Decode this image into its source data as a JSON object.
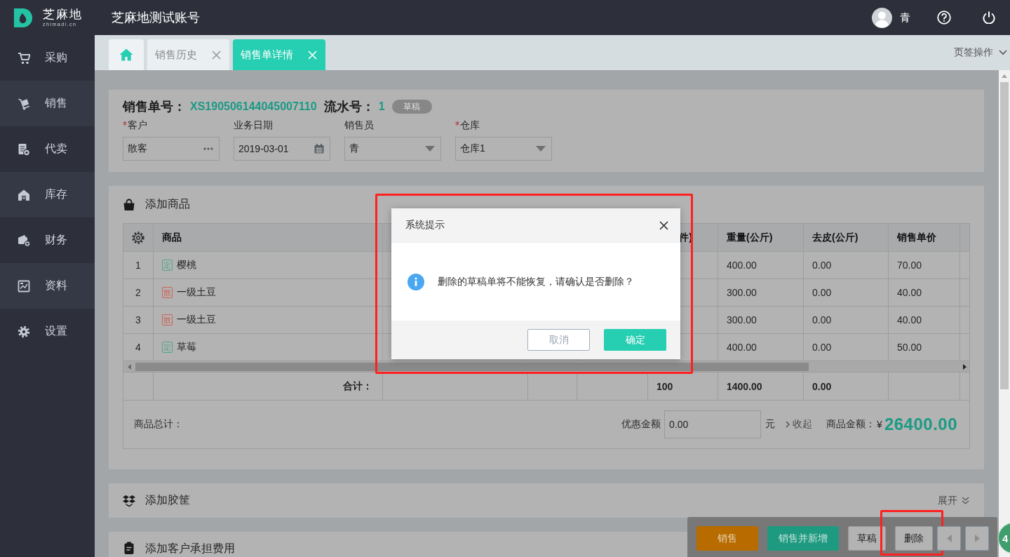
{
  "header": {
    "brand": "芝麻地",
    "domain": "zhimadi.cn",
    "account": "芝麻地测试账号",
    "user": "青"
  },
  "sidebar": {
    "items": [
      {
        "label": "采购"
      },
      {
        "label": "销售"
      },
      {
        "label": "代卖"
      },
      {
        "label": "库存"
      },
      {
        "label": "财务"
      },
      {
        "label": "资料"
      },
      {
        "label": "设置"
      }
    ]
  },
  "tabs": [
    {
      "kind": "home",
      "selected": false
    },
    {
      "kind": "page",
      "label": "销售历史",
      "selected": false,
      "closable": true
    },
    {
      "kind": "page",
      "label": "销售单详情",
      "selected": true,
      "closable": true
    }
  ],
  "tab_actions": "页签操作",
  "order": {
    "number_label": "销售单号：",
    "number": "XS190506144045007110",
    "serial_label": "流水号：",
    "serial": "1",
    "status": "草稿",
    "fields": [
      {
        "label": "客户",
        "required": true,
        "kind": "picker",
        "value": "散客"
      },
      {
        "label": "业务日期",
        "required": false,
        "kind": "date",
        "value": "2019-03-01"
      },
      {
        "label": "销售员",
        "required": false,
        "kind": "select",
        "value": "青"
      },
      {
        "label": "仓库",
        "required": true,
        "kind": "select",
        "value": "仓库1"
      }
    ]
  },
  "goods": {
    "title": "添加商品",
    "table": {
      "columns": [
        {
          "label": "商品"
        },
        {
          "label": "件)"
        },
        {
          "label": "重量(公斤)"
        },
        {
          "label": "去皮(公斤)"
        },
        {
          "label": "销售单价"
        }
      ],
      "rows": [
        {
          "index": "1",
          "tag": {
            "text": "定",
            "color": "#52a389"
          },
          "name": "樱桃",
          "weight": "400.00",
          "tare": "0.00",
          "price": "70.00"
        },
        {
          "index": "2",
          "tag": {
            "text": "散",
            "color": "#cc6459"
          },
          "name": "一级土豆",
          "weight": "300.00",
          "tare": "0.00",
          "price": "40.00"
        },
        {
          "index": "3",
          "tag": {
            "text": "散",
            "color": "#cc6459"
          },
          "name": "一级土豆",
          "weight": "300.00",
          "tare": "0.00",
          "price": "40.00"
        },
        {
          "index": "4",
          "tag": {
            "text": "定",
            "color": "#52a389"
          },
          "name": "草莓",
          "weight": "400.00",
          "tare": "0.00",
          "price": "50.00"
        }
      ],
      "totals": {
        "label": "合计：",
        "quantity": "100",
        "weight": "1400.00",
        "tare": "0.00"
      }
    },
    "summary": {
      "label": "商品总计：",
      "discount_label": "优惠金额",
      "discount": "0.00",
      "unit": "元",
      "collapse": "收起",
      "amount_label": "商品金额：",
      "currency": "¥",
      "amount": "26400.00"
    }
  },
  "crates": {
    "title": "添加胶筐",
    "expand": "展开"
  },
  "fees": {
    "title": "添加客户承担费用"
  },
  "actions": [
    {
      "label": "销售",
      "kind": "warning",
      "highlighted": false
    },
    {
      "label": "销售并新增",
      "kind": "success",
      "highlighted": false
    },
    {
      "label": "草稿",
      "kind": "default",
      "highlighted": false
    },
    {
      "label": "删除",
      "kind": "default",
      "highlighted": true
    },
    {
      "kind": "prev",
      "highlighted": false
    },
    {
      "kind": "next",
      "highlighted": false
    }
  ],
  "floating_ball": {
    "text": "4"
  },
  "dialog": {
    "title": "系统提示",
    "message": "删除的草稿单将不能恢复，请确认是否删除？",
    "highlighted": true,
    "buttons": [
      {
        "label": "取消",
        "kind": "default"
      },
      {
        "label": "确定",
        "kind": "primary"
      }
    ]
  }
}
